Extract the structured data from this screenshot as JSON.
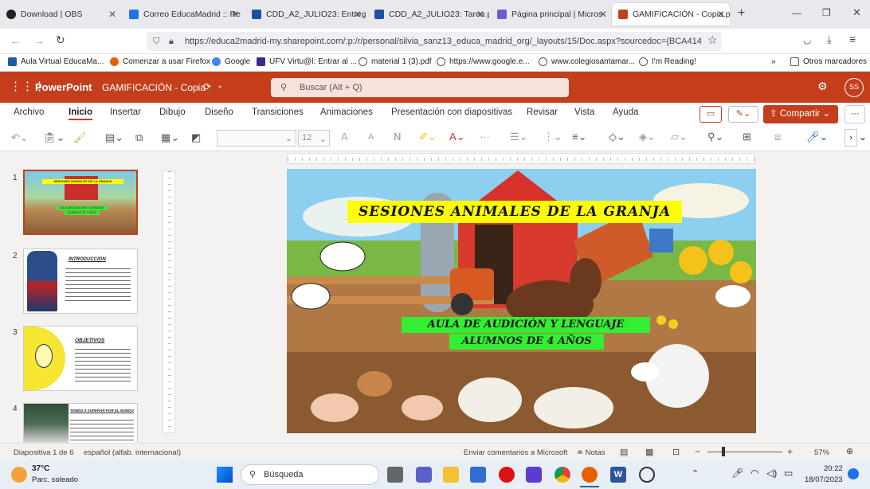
{
  "browser": {
    "tabs": [
      {
        "label": "Download | OBS",
        "color": "#222222"
      },
      {
        "label": "Correo EducaMadrid :: Re",
        "color": "#1a73e8"
      },
      {
        "label": "CDD_A2_JULIO23: Entreg",
        "color": "#1e4fa3"
      },
      {
        "label": "CDD_A2_JULIO23: Tarea p",
        "color": "#1e4fa3"
      },
      {
        "label": "Página principal | Micros",
        "color": "#6b5bd6"
      },
      {
        "label": "GAMIFICACIÓN - Copia.p",
        "color": "#c43e1c"
      }
    ],
    "url": "https://educa2madrid-my.sharepoint.com/:p:/r/personal/silvia_sanz13_educa_madrid_org/_layouts/15/Doc.aspx?sourcedoc={BCA414",
    "bookmarks": [
      "Aula Virtual EducaMa...",
      "Comenzar a usar Firefox",
      "Google",
      "UFV Virtu@l: Entrar al ...",
      "material 1 (3).pdf",
      "https://www.google.e...",
      "www.colegiosantamar...",
      "I'm Reading!"
    ],
    "other_bookmarks": "Otros marcadores"
  },
  "office": {
    "app_name": "PowerPoint",
    "doc_title": "GAMIFICACIÓN - Copia",
    "search_placeholder": "Buscar (Alt + Q)",
    "user_initials": "SS",
    "ribbon_tabs": [
      "Archivo",
      "Inicio",
      "Insertar",
      "Dibujo",
      "Diseño",
      "Transiciones",
      "Animaciones",
      "Presentación con diapositivas",
      "Revisar",
      "Vista",
      "Ayuda"
    ],
    "share_label": "Compartir",
    "font_size": "12"
  },
  "slides": {
    "numbers": [
      "1",
      "2",
      "3",
      "4"
    ],
    "thumb2_title": "INTRODUCCIÓN",
    "thumb3_title": "OBJETIVOS",
    "thumb4_title": "TENÉIS A SUPERAR POR EL MUNDO",
    "main_title": "SESIONES ANIMALES DE LA GRANJA",
    "main_line1": "AULA DE AUDICIÓN Y LENGUAJE",
    "main_line2": "ALUMNOS DE 4 AÑOS",
    "thumb1_title": "SESIONES ANIMALES DE LA GRANJA",
    "thumb1_line1": "AULA DE AUDICIÓN Y LENGUAJE",
    "thumb1_line2": "ALUMNOS DE 4 AÑOS"
  },
  "status": {
    "slide_info": "Diapositiva 1 de 6",
    "language": "español (alfab. internacional)",
    "feedback": "Enviar comentarios a Microsoft",
    "notes": "Notas",
    "zoom": "57%"
  },
  "taskbar": {
    "temp": "37°C",
    "weather": "Parc. soleado",
    "search": "Búsqueda",
    "time": "20:22",
    "date": "18/07/2023"
  },
  "colors": {
    "brand": "#c43e1c",
    "title_bg": "#ffff00",
    "green_bg": "#33ee33"
  }
}
